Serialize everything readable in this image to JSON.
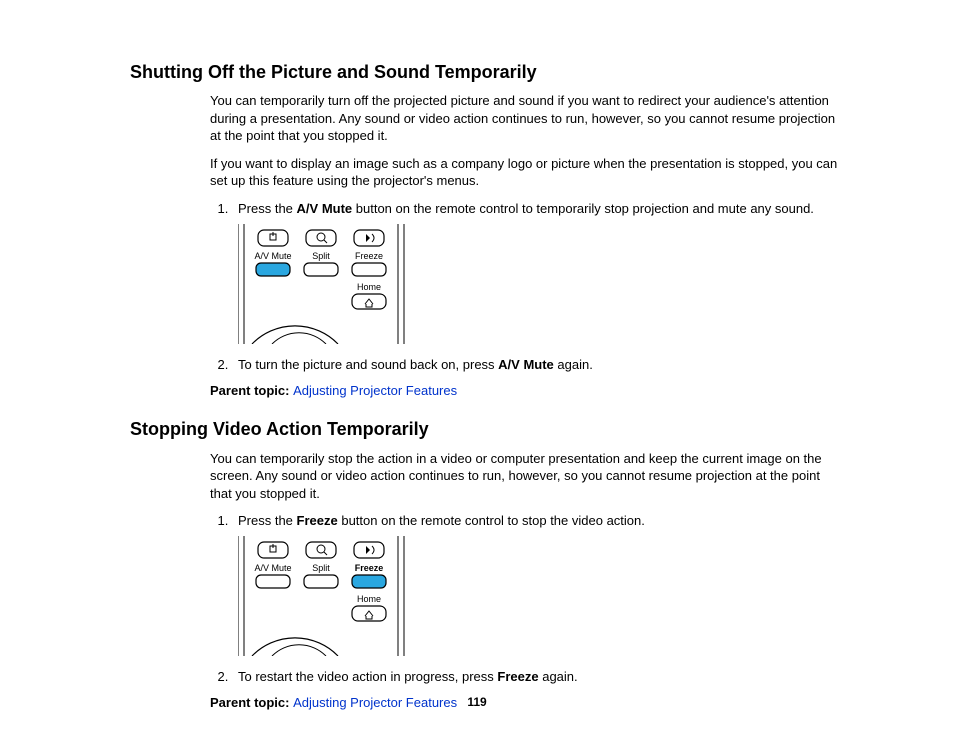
{
  "page_number": "119",
  "section1": {
    "title": "Shutting Off the Picture and Sound Temporarily",
    "p1": "You can temporarily turn off the projected picture and sound if you want to redirect your audience's attention during a presentation. Any sound or video action continues to run, however, so you cannot resume projection at the point that you stopped it.",
    "p2": "If you want to display an image such as a company logo or picture when the presentation is stopped, you can set up this feature using the projector's menus.",
    "step1_pre": "Press the ",
    "step1_bold": "A/V Mute",
    "step1_post": " button on the remote control to temporarily stop projection and mute any sound.",
    "step2_pre": "To turn the picture and sound back on, press ",
    "step2_bold": "A/V Mute",
    "step2_post": " again.",
    "parent_label": "Parent topic: ",
    "parent_link": "Adjusting Projector Features"
  },
  "section2": {
    "title": "Stopping Video Action Temporarily",
    "p1": "You can temporarily stop the action in a video or computer presentation and keep the current image on the screen. Any sound or video action continues to run, however, so you cannot resume projection at the point that you stopped it.",
    "step1_pre": "Press the ",
    "step1_bold": "Freeze",
    "step1_post": " button on the remote control to stop the video action.",
    "step2_pre": "To restart the video action in progress, press ",
    "step2_bold": "Freeze",
    "step2_post": " again.",
    "parent_label": "Parent topic: ",
    "parent_link": "Adjusting Projector Features"
  },
  "remote": {
    "labels": {
      "avmute": "A/V Mute",
      "split": "Split",
      "freeze": "Freeze",
      "home": "Home"
    }
  }
}
